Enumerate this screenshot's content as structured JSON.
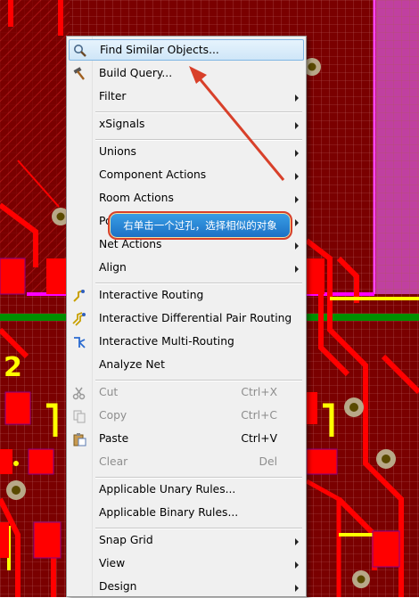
{
  "menu": {
    "items": [
      {
        "label": "Find Similar Objects...",
        "icon": "magnifier-icon",
        "highlighted": true
      },
      {
        "label": "Build Query...",
        "icon": "hammer-icon"
      },
      {
        "label": "Filter",
        "submenu": true
      },
      {
        "label": "xSignals",
        "submenu": true
      },
      {
        "label": "Unions",
        "submenu": true
      },
      {
        "label": "Component Actions",
        "submenu": true
      },
      {
        "label": "Room Actions",
        "submenu": true
      },
      {
        "label": "Po",
        "submenu": true
      },
      {
        "label": "Net Actions",
        "submenu": true
      },
      {
        "label": "Align",
        "submenu": true
      },
      {
        "label": "Interactive Routing",
        "icon": "route-icon"
      },
      {
        "label": "Interactive Differential Pair Routing",
        "icon": "diff-pair-route-icon"
      },
      {
        "label": "Interactive Multi-Routing",
        "icon": "multi-route-icon"
      },
      {
        "label": "Analyze Net"
      },
      {
        "label": "Cut",
        "shortcut": "Ctrl+X",
        "icon": "scissors-icon",
        "disabled": true
      },
      {
        "label": "Copy",
        "shortcut": "Ctrl+C",
        "icon": "copy-icon",
        "disabled": true
      },
      {
        "label": "Paste",
        "shortcut": "Ctrl+V",
        "icon": "paste-icon"
      },
      {
        "label": "Clear",
        "shortcut": "Del",
        "disabled": true
      },
      {
        "label": "Applicable Unary Rules..."
      },
      {
        "label": "Applicable Binary Rules..."
      },
      {
        "label": "Snap Grid",
        "submenu": true
      },
      {
        "label": "View",
        "submenu": true
      },
      {
        "label": "Design",
        "submenu": true
      }
    ]
  },
  "annotation": {
    "callout_text": "右单击一个过孔，选择相似的对象",
    "color": "#d8402a"
  },
  "board": {
    "silkscreen_label": "2",
    "colors": {
      "copper": "#ff0000",
      "board": "#7a0000",
      "silk": "#ffff00",
      "keepout": "#ff00ff",
      "ground": "#00a000"
    }
  }
}
